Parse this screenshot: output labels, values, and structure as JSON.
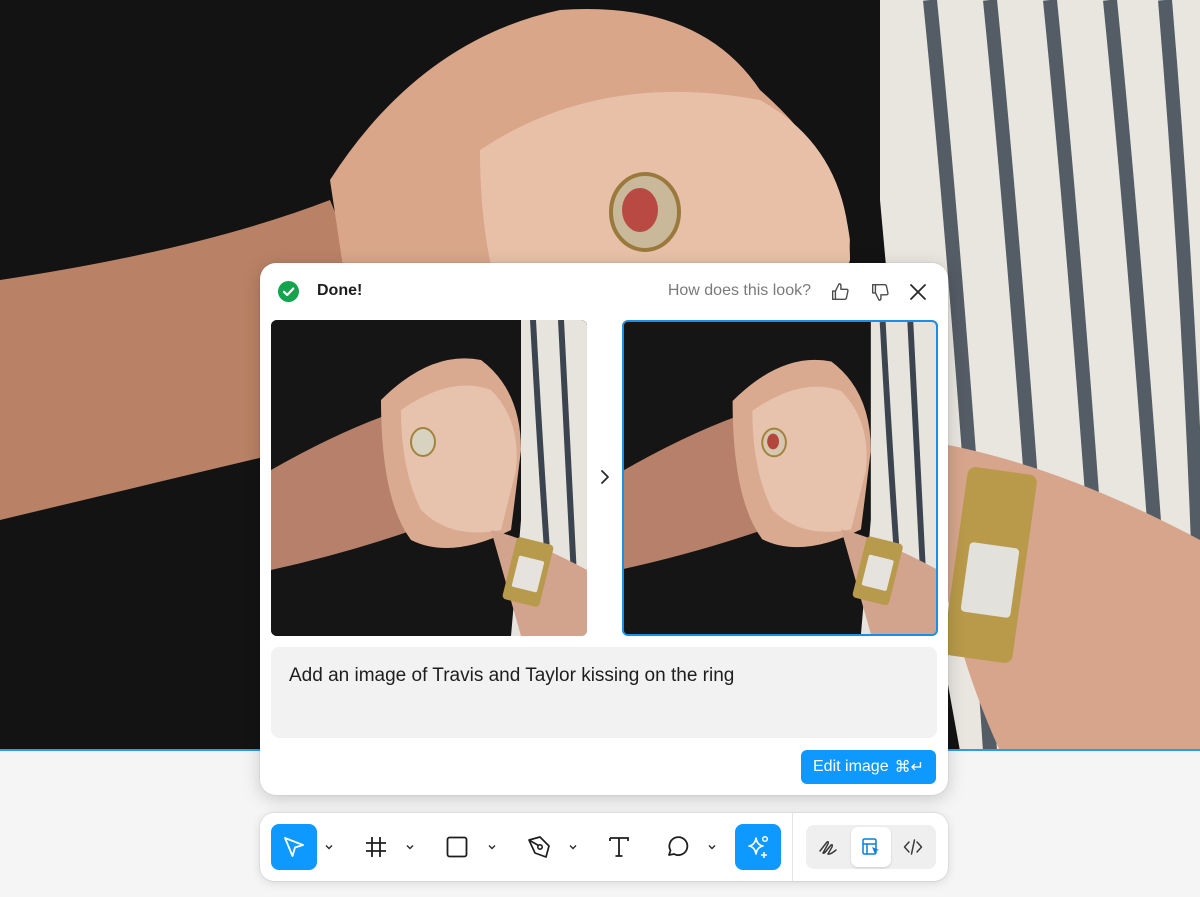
{
  "dialog": {
    "status": "Done!",
    "feedback_question": "How does this look?",
    "prompt": "Add an image of Travis and Taylor kissing on the ring",
    "edit_button_label": "Edit image",
    "edit_button_shortcut": "⌘↵"
  },
  "icons": {
    "status": "check-circle-icon",
    "thumb_up": "thumbs-up-icon",
    "thumb_down": "thumbs-down-icon",
    "close": "close-icon",
    "next": "chevron-right-icon"
  },
  "toolbar": {
    "tools": [
      "move-tool",
      "frame-tool",
      "rectangle-tool",
      "pen-tool",
      "text-tool",
      "comment-tool",
      "ai-actions-tool"
    ],
    "modes": [
      "draw-mode",
      "design-mode",
      "dev-mode"
    ],
    "active_tool": "move-tool",
    "active_mode": "design-mode"
  },
  "colors": {
    "accent": "#0d99ff",
    "success": "#14a44d",
    "selection_border": "#1b8fe6"
  }
}
